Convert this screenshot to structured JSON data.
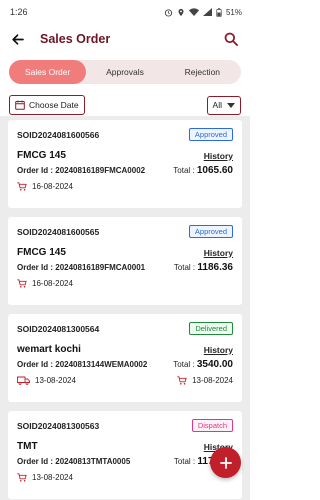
{
  "status_bar": {
    "time": "1:26",
    "battery": "51%"
  },
  "header": {
    "title": "Sales Order"
  },
  "tabs": [
    {
      "label": "Sales Order",
      "active": true
    },
    {
      "label": "Approvals",
      "active": false
    },
    {
      "label": "Rejection",
      "active": false
    }
  ],
  "filters": {
    "date_label": "Choose Date",
    "status_value": "All"
  },
  "orders": [
    {
      "soid": "SOID2024081600566",
      "status": "Approved",
      "status_class": "approved",
      "customer": "FMCG 145",
      "history_label": "History",
      "order_label": "Order Id :",
      "order_id": "20240816189FMCA0002",
      "total_label": "Total :",
      "total": "1065.60",
      "date": "16-08-2024",
      "delivery_date": ""
    },
    {
      "soid": "SOID2024081600565",
      "status": "Approved",
      "status_class": "approved",
      "customer": "FMCG 145",
      "history_label": "History",
      "order_label": "Order Id :",
      "order_id": "20240816189FMCA0001",
      "total_label": "Total :",
      "total": "1186.36",
      "date": "16-08-2024",
      "delivery_date": ""
    },
    {
      "soid": "SOID2024081300564",
      "status": "Delivered",
      "status_class": "delivered",
      "customer": "wemart kochi",
      "history_label": "History",
      "order_label": "Order Id :",
      "order_id": "20240813144WEMA0002",
      "total_label": "Total :",
      "total": "3540.00",
      "date": "13-08-2024",
      "delivery_date": "13-08-2024"
    },
    {
      "soid": "SOID2024081300563",
      "status": "Dispatch",
      "status_class": "dispatch",
      "customer": "TMT",
      "history_label": "History",
      "order_label": "Order Id :",
      "order_id": "20240813TMTA0005",
      "total_label": "Total :",
      "total": "1172.91",
      "date": "13-08-2024",
      "delivery_date": ""
    }
  ],
  "icons": {
    "back": "arrow-left-icon",
    "search": "search-icon",
    "calendar": "calendar-icon",
    "cart": "cart-icon",
    "truck": "truck-icon",
    "add": "plus-icon"
  },
  "colors": {
    "brand": "#6e1524",
    "active_tab": "#f17c7c",
    "fab": "#c0202a"
  }
}
